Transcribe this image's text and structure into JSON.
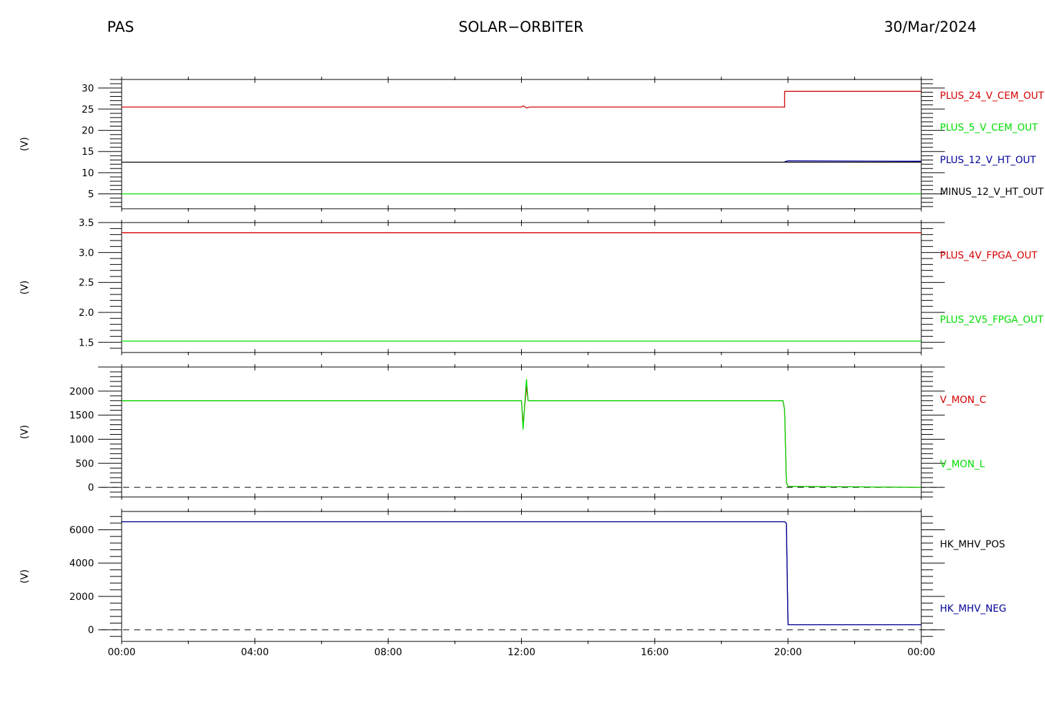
{
  "header": {
    "left": "PAS",
    "center": "SOLAR−ORBITER",
    "right": "30/Mar/2024"
  },
  "x_ticks": [
    "00:00",
    "04:00",
    "08:00",
    "12:00",
    "16:00",
    "20:00",
    "00:00"
  ],
  "chart_data": [
    {
      "type": "line",
      "ylabel": "(V)",
      "ylim": [
        1.5,
        32
      ],
      "yticks": [
        5,
        10,
        15,
        20,
        25,
        30
      ],
      "ytick_labels": [
        "5",
        "10",
        "15",
        "20",
        "25",
        "30"
      ],
      "legend": [
        {
          "label": "PLUS_24_V_CEM_OUT",
          "color": "#d40000"
        },
        {
          "label": "PLUS_5_V_CEM_OUT",
          "color": "#00dd00"
        },
        {
          "label": "PLUS_12_V_HT_OUT",
          "color": "#00009b"
        },
        {
          "label": "MINUS_12_V_HT_OUT",
          "color": "#000000"
        }
      ],
      "series": [
        {
          "name": "PLUS_24_V_CEM_OUT",
          "color": "#d40000",
          "x": [
            0,
            12.0,
            12.05,
            12.15,
            12.25,
            19.9,
            19.9,
            24
          ],
          "y": [
            25.5,
            25.5,
            25.8,
            25.3,
            25.5,
            25.5,
            29.2,
            29.2
          ]
        },
        {
          "name": "PLUS_5_V_CEM_OUT",
          "color": "#00dd00",
          "x": [
            0,
            24
          ],
          "y": [
            5.0,
            5.0
          ]
        },
        {
          "name": "MINUS_12_V_HT_OUT",
          "color": "#000000",
          "x": [
            0,
            19.9,
            19.9,
            24
          ],
          "y": [
            12.5,
            12.5,
            12.5,
            12.5
          ]
        },
        {
          "name": "PLUS_12_V_HT_OUT",
          "color": "#00009b",
          "x": [
            19.9,
            20.0,
            24
          ],
          "y": [
            12.6,
            12.8,
            12.7
          ]
        }
      ],
      "dashed_zero": false
    },
    {
      "type": "line",
      "ylabel": "(V)",
      "ylim": [
        1.33,
        3.5
      ],
      "yticks": [
        1.5,
        2.0,
        2.5,
        3.0,
        3.5
      ],
      "ytick_labels": [
        "1.5",
        "2.0",
        "2.5",
        "3.0",
        "3.5"
      ],
      "legend": [
        {
          "label": "PLUS_4V_FPGA_OUT",
          "color": "#d40000"
        },
        {
          "label": "PLUS_2V5_FPGA_OUT",
          "color": "#00dd00"
        }
      ],
      "series": [
        {
          "name": "PLUS_4V_FPGA_OUT",
          "color": "#d40000",
          "x": [
            0,
            24
          ],
          "y": [
            3.33,
            3.33
          ]
        },
        {
          "name": "PLUS_2V5_FPGA_OUT",
          "color": "#00dd00",
          "x": [
            0,
            24
          ],
          "y": [
            1.52,
            1.52
          ]
        }
      ],
      "dashed_zero": false
    },
    {
      "type": "line",
      "ylabel": "(V)",
      "ylim": [
        -200,
        2500
      ],
      "yticks": [
        0,
        500,
        1000,
        1500,
        2000
      ],
      "ytick_labels": [
        "0",
        "500",
        "1000",
        "1500",
        "2000"
      ],
      "legend": [
        {
          "label": "V_MON_C",
          "color": "#d40000"
        },
        {
          "label": "V_MON_L",
          "color": "#00dd00"
        }
      ],
      "series": [
        {
          "name": "V_MON_C",
          "color": "#d40000",
          "x": [
            0,
            12.0,
            12.05,
            12.1,
            12.15,
            12.2,
            19.85,
            19.9,
            19.95,
            20.0,
            24
          ],
          "y": [
            1800,
            1800,
            1300,
            1700,
            2100,
            1800,
            1800,
            1600,
            100,
            20,
            0
          ]
        },
        {
          "name": "V_MON_L",
          "color": "#00dd00",
          "x": [
            0,
            12.0,
            12.05,
            12.1,
            12.15,
            12.2,
            19.85,
            19.9,
            19.95,
            20.0,
            24
          ],
          "y": [
            1800,
            1800,
            1200,
            1750,
            2250,
            1800,
            1800,
            1600,
            100,
            20,
            0
          ]
        }
      ],
      "dashed_zero": true
    },
    {
      "type": "line",
      "ylabel": "(V)",
      "ylim": [
        -700,
        7100
      ],
      "yticks": [
        0,
        2000,
        4000,
        6000
      ],
      "ytick_labels": [
        "0",
        "2000",
        "4000",
        "6000"
      ],
      "legend": [
        {
          "label": "HK_MHV_POS",
          "color": "#000000"
        },
        {
          "label": "HK_MHV_NEG",
          "color": "#00009b"
        }
      ],
      "series": [
        {
          "name": "HK_MHV_POS",
          "color": "#000000",
          "x": [
            0,
            19.9,
            19.95,
            20.0,
            24
          ],
          "y": [
            6480,
            6480,
            6400,
            300,
            300
          ]
        },
        {
          "name": "HK_MHV_NEG",
          "color": "#00009b",
          "x": [
            0,
            19.9,
            19.95,
            20.0,
            24
          ],
          "y": [
            6480,
            6480,
            6400,
            300,
            300
          ]
        }
      ],
      "dashed_zero": true
    }
  ]
}
